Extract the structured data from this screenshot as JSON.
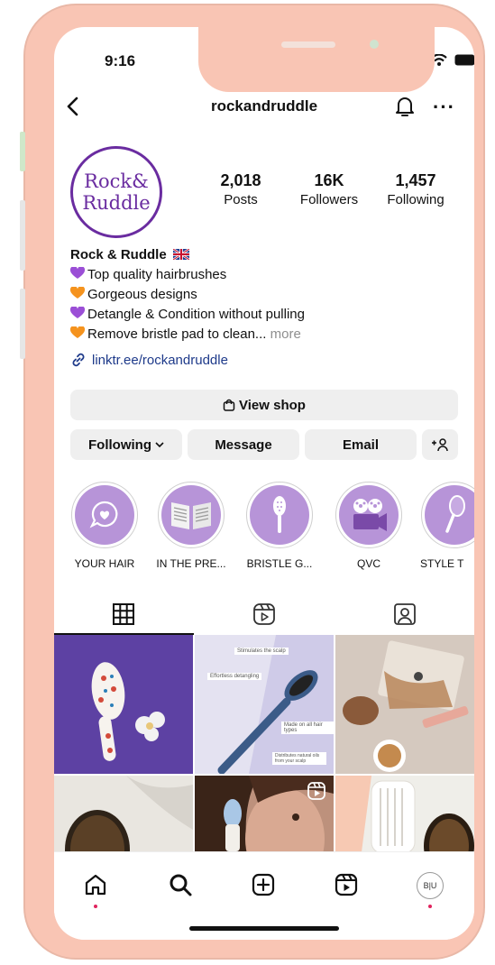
{
  "status": {
    "time": "9:16"
  },
  "header": {
    "username": "rockandruddle"
  },
  "profile": {
    "avatar_line1": "Rock&",
    "avatar_line2": "Ruddle",
    "stats": [
      {
        "value": "2,018",
        "label": "Posts"
      },
      {
        "value": "16K",
        "label": "Followers"
      },
      {
        "value": "1,457",
        "label": "Following"
      }
    ],
    "name": "Rock & Ruddle",
    "bio": [
      {
        "text": "Top quality hairbrushes",
        "heart": "purple"
      },
      {
        "text": "Gorgeous designs",
        "heart": "orange"
      },
      {
        "text": "Detangle & Condition without pulling",
        "heart": "purple"
      },
      {
        "text": "Remove bristle pad to clean...",
        "heart": "orange"
      }
    ],
    "more_label": "more",
    "link": "linktr.ee/rockandruddle"
  },
  "actions": {
    "view_shop": "View shop",
    "following": "Following",
    "message": "Message",
    "email": "Email",
    "add_person": "+ዾ"
  },
  "highlights": [
    {
      "label": "YOUR HAIR",
      "icon": "speech-heart-icon"
    },
    {
      "label": "IN THE PRE...",
      "icon": "newspaper-icon"
    },
    {
      "label": "BRISTLE G...",
      "icon": "brush-icon"
    },
    {
      "label": "QVC",
      "icon": "video-camera-icon"
    },
    {
      "label": "STYLE T",
      "icon": "mirror-icon"
    }
  ],
  "posts": {
    "tile2_caption_1": "Stimulates the scalp",
    "tile2_caption_2": "Effortless detangling",
    "tile2_caption_3": "Made on all hair types",
    "tile2_caption_4": "Distributes natural oils from your scalp"
  },
  "colors": {
    "brand_purple": "#6a2ca0",
    "highlight_fill": "#b794d8",
    "frame_peach": "#f9c5b4",
    "link_blue": "#1e3a8a",
    "notification_dot": "#e0245e"
  },
  "bottom_nav": {
    "avatar_initials": "B|U"
  }
}
